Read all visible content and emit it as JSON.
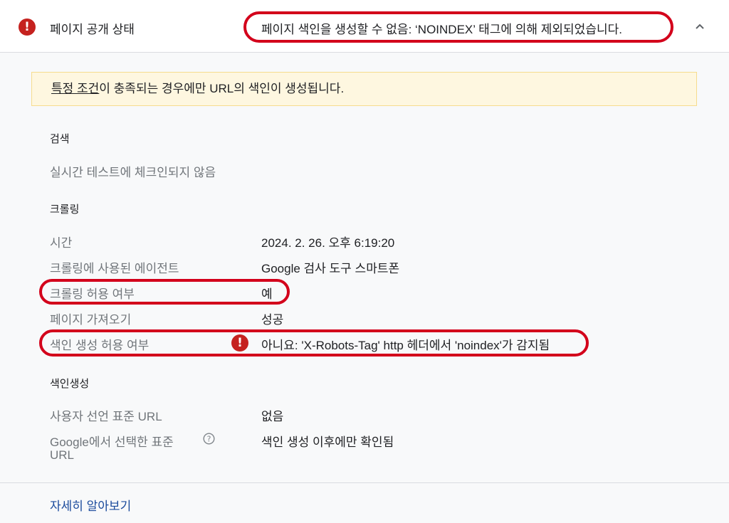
{
  "header": {
    "title": "페이지 공개 상태",
    "status": "페이지 색인을 생성할 수 없음: ‘NOINDEX’ 태그에 의해 제외되었습니다.",
    "collapse_icon": "chevron-up-icon",
    "status_icon": "error-icon"
  },
  "notice": {
    "link_text": "특정 조건",
    "text": "이 충족되는 경우에만 URL의 색인이 생성됩니다."
  },
  "sections": {
    "search": {
      "title": "검색",
      "text": "실시간 테스트에 체크인되지 않음"
    },
    "crawling": {
      "title": "크롤링",
      "rows": [
        {
          "label": "시간",
          "value": "2024. 2. 26. 오후 6:19:20"
        },
        {
          "label": "크롤링에 사용된 에이전트",
          "value": "Google 검사 도구 스마트폰"
        },
        {
          "label": "크롤링 허용 여부",
          "value": "예"
        },
        {
          "label": "페이지 가져오기",
          "value": "성공"
        },
        {
          "label": "색인 생성 허용 여부",
          "value": "아니요: 'X-Robots-Tag' http 헤더에서 'noindex'가 감지됨"
        }
      ]
    },
    "indexing": {
      "title": "색인생성",
      "rows": [
        {
          "label": "사용자 선언 표준 URL",
          "value": "없음"
        },
        {
          "label_line1": "Google에서 선택한 표준",
          "label_line2": "URL",
          "value": "색인 생성 이후에만 확인됨"
        }
      ]
    }
  },
  "footer": {
    "learn_more": "자세히 알아보기"
  },
  "colors": {
    "error": "#c5221f",
    "annotation": "#d3001b",
    "notice_bg": "#fef7e0",
    "link": "#1a4a9c"
  }
}
